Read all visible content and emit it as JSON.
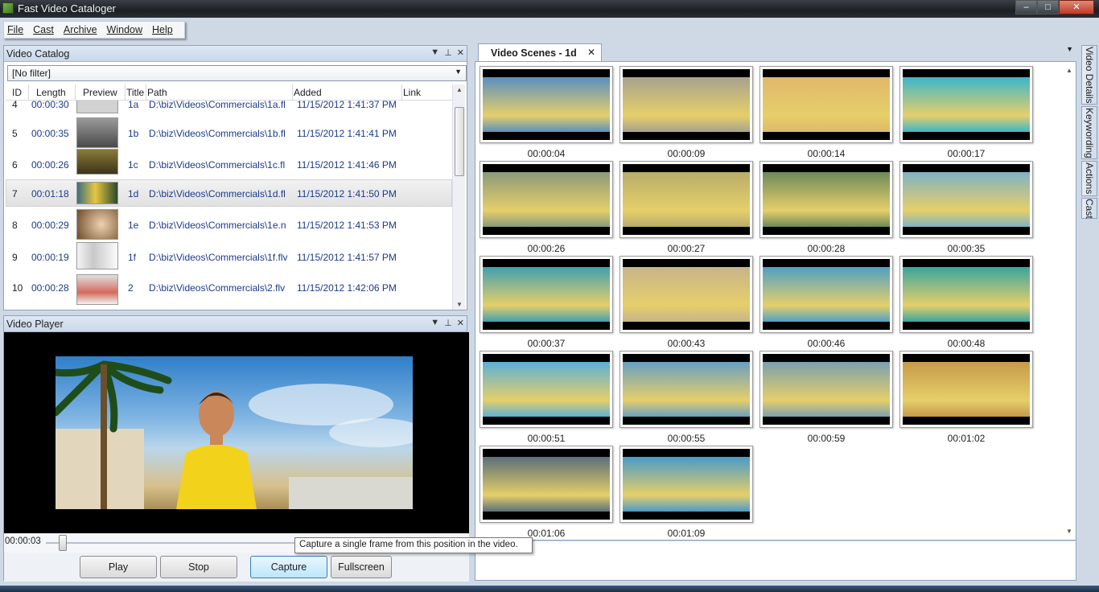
{
  "window": {
    "title": "Fast Video Cataloger",
    "min": "–",
    "max": "□",
    "close": "✕"
  },
  "menu": [
    "File",
    "Cast",
    "Archive",
    "Window",
    "Help"
  ],
  "catalog": {
    "title": "Video Catalog",
    "filter": "[No filter]",
    "columns": [
      "ID",
      "Length",
      "Preview",
      "Title",
      "Path",
      "Added",
      "Link"
    ],
    "rows": [
      {
        "id": "4",
        "length": "00:00:30",
        "title": "1a",
        "path": "D:\\biz\\Videos\\Commercials\\1a.fl",
        "added": "11/15/2012 1:41:37 PM",
        "thumb": "#c9c9c9"
      },
      {
        "id": "5",
        "length": "00:00:35",
        "title": "1b",
        "path": "D:\\biz\\Videos\\Commercials\\1b.fl",
        "added": "11/15/2012 1:41:41 PM",
        "thumb": "#7a7a7a"
      },
      {
        "id": "6",
        "length": "00:00:26",
        "title": "1c",
        "path": "D:\\biz\\Videos\\Commercials\\1c.fl",
        "added": "11/15/2012 1:41:46 PM",
        "thumb": "#6b5a2c"
      },
      {
        "id": "7",
        "length": "00:01:18",
        "title": "1d",
        "path": "D:\\biz\\Videos\\Commercials\\1d.fl",
        "added": "11/15/2012 1:41:50 PM",
        "thumb": "#4f7f58"
      },
      {
        "id": "8",
        "length": "00:00:29",
        "title": "1e",
        "path": "D:\\biz\\Videos\\Commercials\\1e.n",
        "added": "11/15/2012 1:41:53 PM",
        "thumb": "#d8b08a"
      },
      {
        "id": "9",
        "length": "00:00:19",
        "title": "1f",
        "path": "D:\\biz\\Videos\\Commercials\\1f.flv",
        "added": "11/15/2012 1:41:57 PM",
        "thumb": "#e8e8e8"
      },
      {
        "id": "10",
        "length": "00:00:28",
        "title": "2",
        "path": "D:\\biz\\Videos\\Commercials\\2.flv",
        "added": "11/15/2012 1:42:06 PM",
        "thumb": "#d46a5c"
      }
    ]
  },
  "player": {
    "title": "Video Player",
    "time": "00:00:03",
    "buttons": {
      "play": "Play",
      "stop": "Stop",
      "capture": "Capture",
      "fullscreen": "Fullscreen"
    },
    "tooltip": "Capture a single frame from this position in the video."
  },
  "scenes": {
    "tab": "Video Scenes - 1d",
    "items": [
      {
        "time": "00:00:04",
        "color": "#5a8fc0"
      },
      {
        "time": "00:00:09",
        "color": "#a7a28e"
      },
      {
        "time": "00:00:14",
        "color": "#e0b86a"
      },
      {
        "time": "00:00:17",
        "color": "#3bb6c9"
      },
      {
        "time": "00:00:26",
        "color": "#8a9a7a"
      },
      {
        "time": "00:00:27",
        "color": "#b8ad6a"
      },
      {
        "time": "00:00:28",
        "color": "#6d8a5a"
      },
      {
        "time": "00:00:35",
        "color": "#7fb3c4"
      },
      {
        "time": "00:00:37",
        "color": "#3f9fb0"
      },
      {
        "time": "00:00:43",
        "color": "#c8b48a"
      },
      {
        "time": "00:00:46",
        "color": "#4fa0c4"
      },
      {
        "time": "00:00:48",
        "color": "#3aa59e"
      },
      {
        "time": "00:00:51",
        "color": "#5bb0d6"
      },
      {
        "time": "00:00:55",
        "color": "#6a9fc2"
      },
      {
        "time": "00:00:59",
        "color": "#7c9fb0"
      },
      {
        "time": "00:01:02",
        "color": "#c79a4a"
      },
      {
        "time": "00:01:06",
        "color": "#5a6f7a"
      },
      {
        "time": "00:01:09",
        "color": "#4a9ac8"
      }
    ]
  },
  "sidetabs": [
    "Video Details",
    "Keywording",
    "Actions",
    "Cast"
  ],
  "colors": {
    "accent": "#3c7fb1",
    "panelHeader": "#c9d8ea",
    "selection": "#e1e1e1"
  }
}
